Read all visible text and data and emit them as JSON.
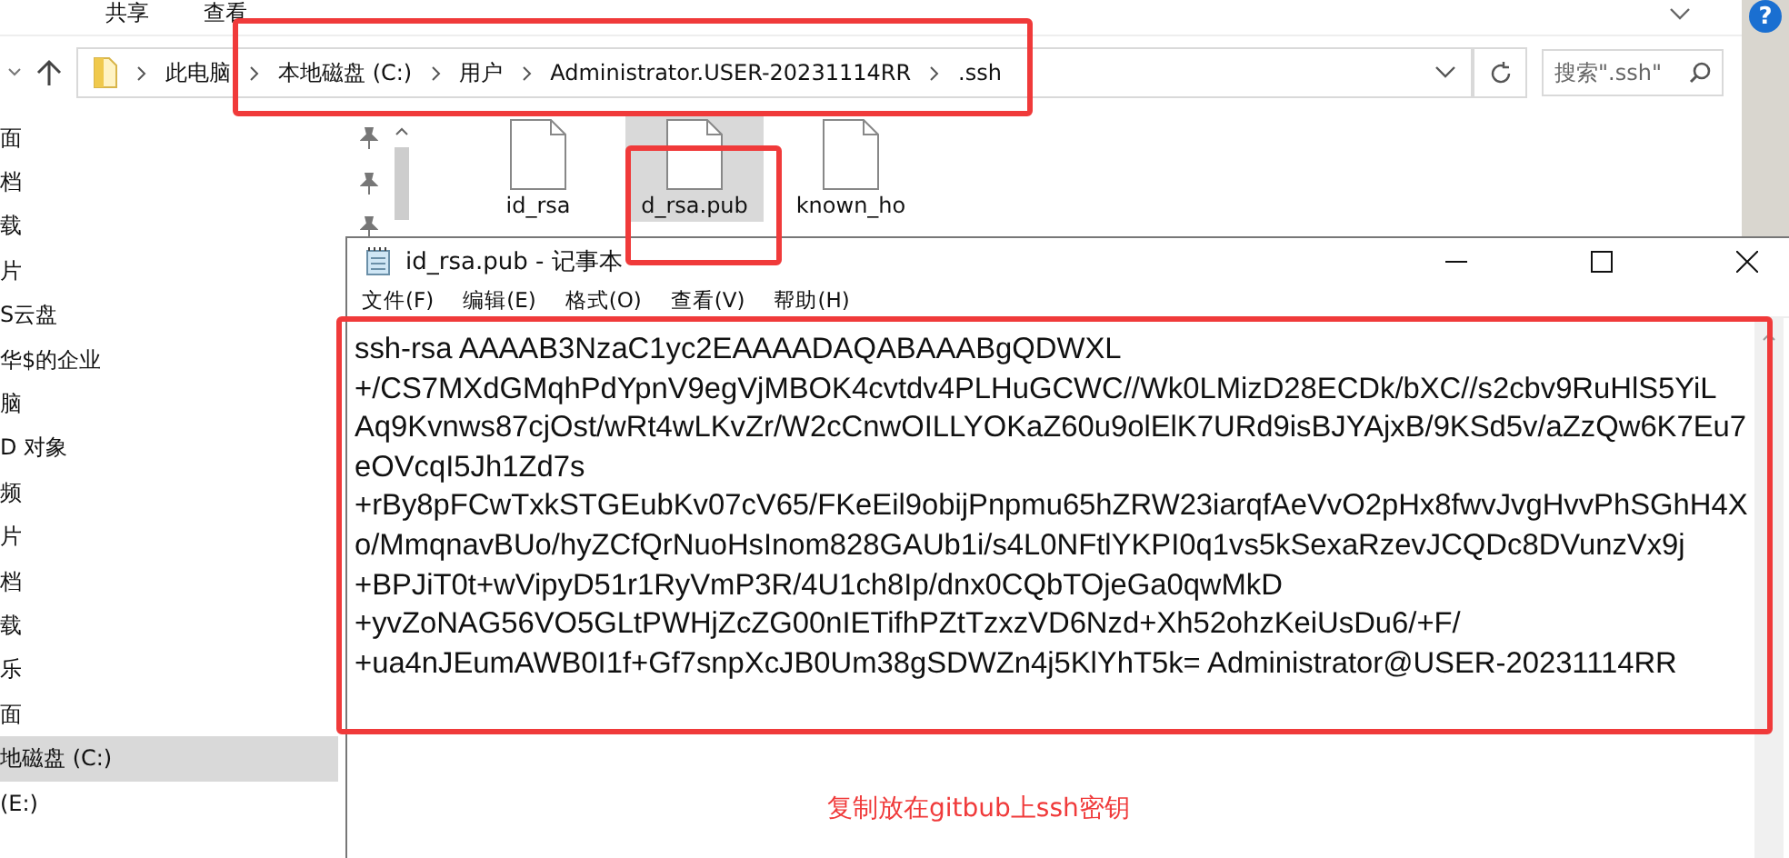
{
  "explorer": {
    "ribbon_tabs": [
      "共享",
      "查看"
    ],
    "help": "?",
    "address": {
      "crumbs": [
        "此电脑",
        "本地磁盘 (C:)",
        "用户",
        "Administrator.USER-20231114RR",
        ".ssh"
      ]
    },
    "search": {
      "placeholder": "搜索\".ssh\""
    },
    "nav_items": [
      {
        "label": "面",
        "pinned": true,
        "selected": false
      },
      {
        "label": "档",
        "pinned": true,
        "selected": false
      },
      {
        "label": "载",
        "pinned": true,
        "selected": false
      },
      {
        "label": "片",
        "selected": false
      },
      {
        "label": "S云盘",
        "selected": false
      },
      {
        "label": "华$的企业",
        "selected": false
      },
      {
        "label": "脑",
        "selected": false
      },
      {
        "label": "D 对象",
        "selected": false
      },
      {
        "label": "频",
        "selected": false
      },
      {
        "label": "片",
        "selected": false
      },
      {
        "label": "档",
        "selected": false
      },
      {
        "label": "载",
        "selected": false
      },
      {
        "label": "乐",
        "selected": false
      },
      {
        "label": "面",
        "selected": false
      },
      {
        "label": "地磁盘 (C:)",
        "selected": true
      },
      {
        "label": "(E:)",
        "selected": false
      }
    ],
    "files": [
      {
        "name": "id_rsa",
        "selected": false
      },
      {
        "name": "d_rsa.pub",
        "selected": true
      },
      {
        "name": "known_ho",
        "selected": false
      }
    ]
  },
  "notepad": {
    "title": "id_rsa.pub - 记事本",
    "menu": [
      "文件(F)",
      "编辑(E)",
      "格式(O)",
      "查看(V)",
      "帮助(H)"
    ],
    "lines": [
      "ssh-rsa AAAAB3NzaC1yc2EAAAADAQABAAABgQDWXL",
      "+/CS7MXdGMqhPdYpnV9egVjMBOK4cvtdv4PLHuGCWC//Wk0LMizD28ECDk/bXC//s2cbv9RuHlS5YiL",
      "Aq9Kvnws87cjOst/wRt4wLKvZr/W2cCnwOILLYOKaZ60u9olElK7URd9isBJYAjxB/9KSd5v/aZzQw6K7Eu7",
      "eOVcqI5Jh1Zd7s",
      "+rBy8pFCwTxkSTGEubKv07cV65/FKeEil9obijPnpmu65hZRW23iarqfAeVvO2pHx8fwvJvgHvvPhSGhH4X",
      "o/MmqnavBUo/hyZCfQrNuoHsInom828GAUb1i/s4L0NFtlYKPI0q1vs5kSexaRzevJCQDc8DVunzVx9j",
      "+BPJiT0t+wVipyD51r1RyVmP3R/4U1ch8Ip/dnx0CQbTOjeGa0qwMkD",
      "+yvZoNAG56VO5GLtPWHjZcZG00nIETifhPZtTzxzVD6Nzd+Xh52ohzKeiUsDu6/+F/",
      "+ua4nJEumAWB0I1f+Gf7snpXcJB0Um38gSDWZn4j5KlYhT5k= Administrator@USER-20231114RR"
    ]
  },
  "annotation": {
    "note": "复制放在gitbub上ssh密钥"
  }
}
